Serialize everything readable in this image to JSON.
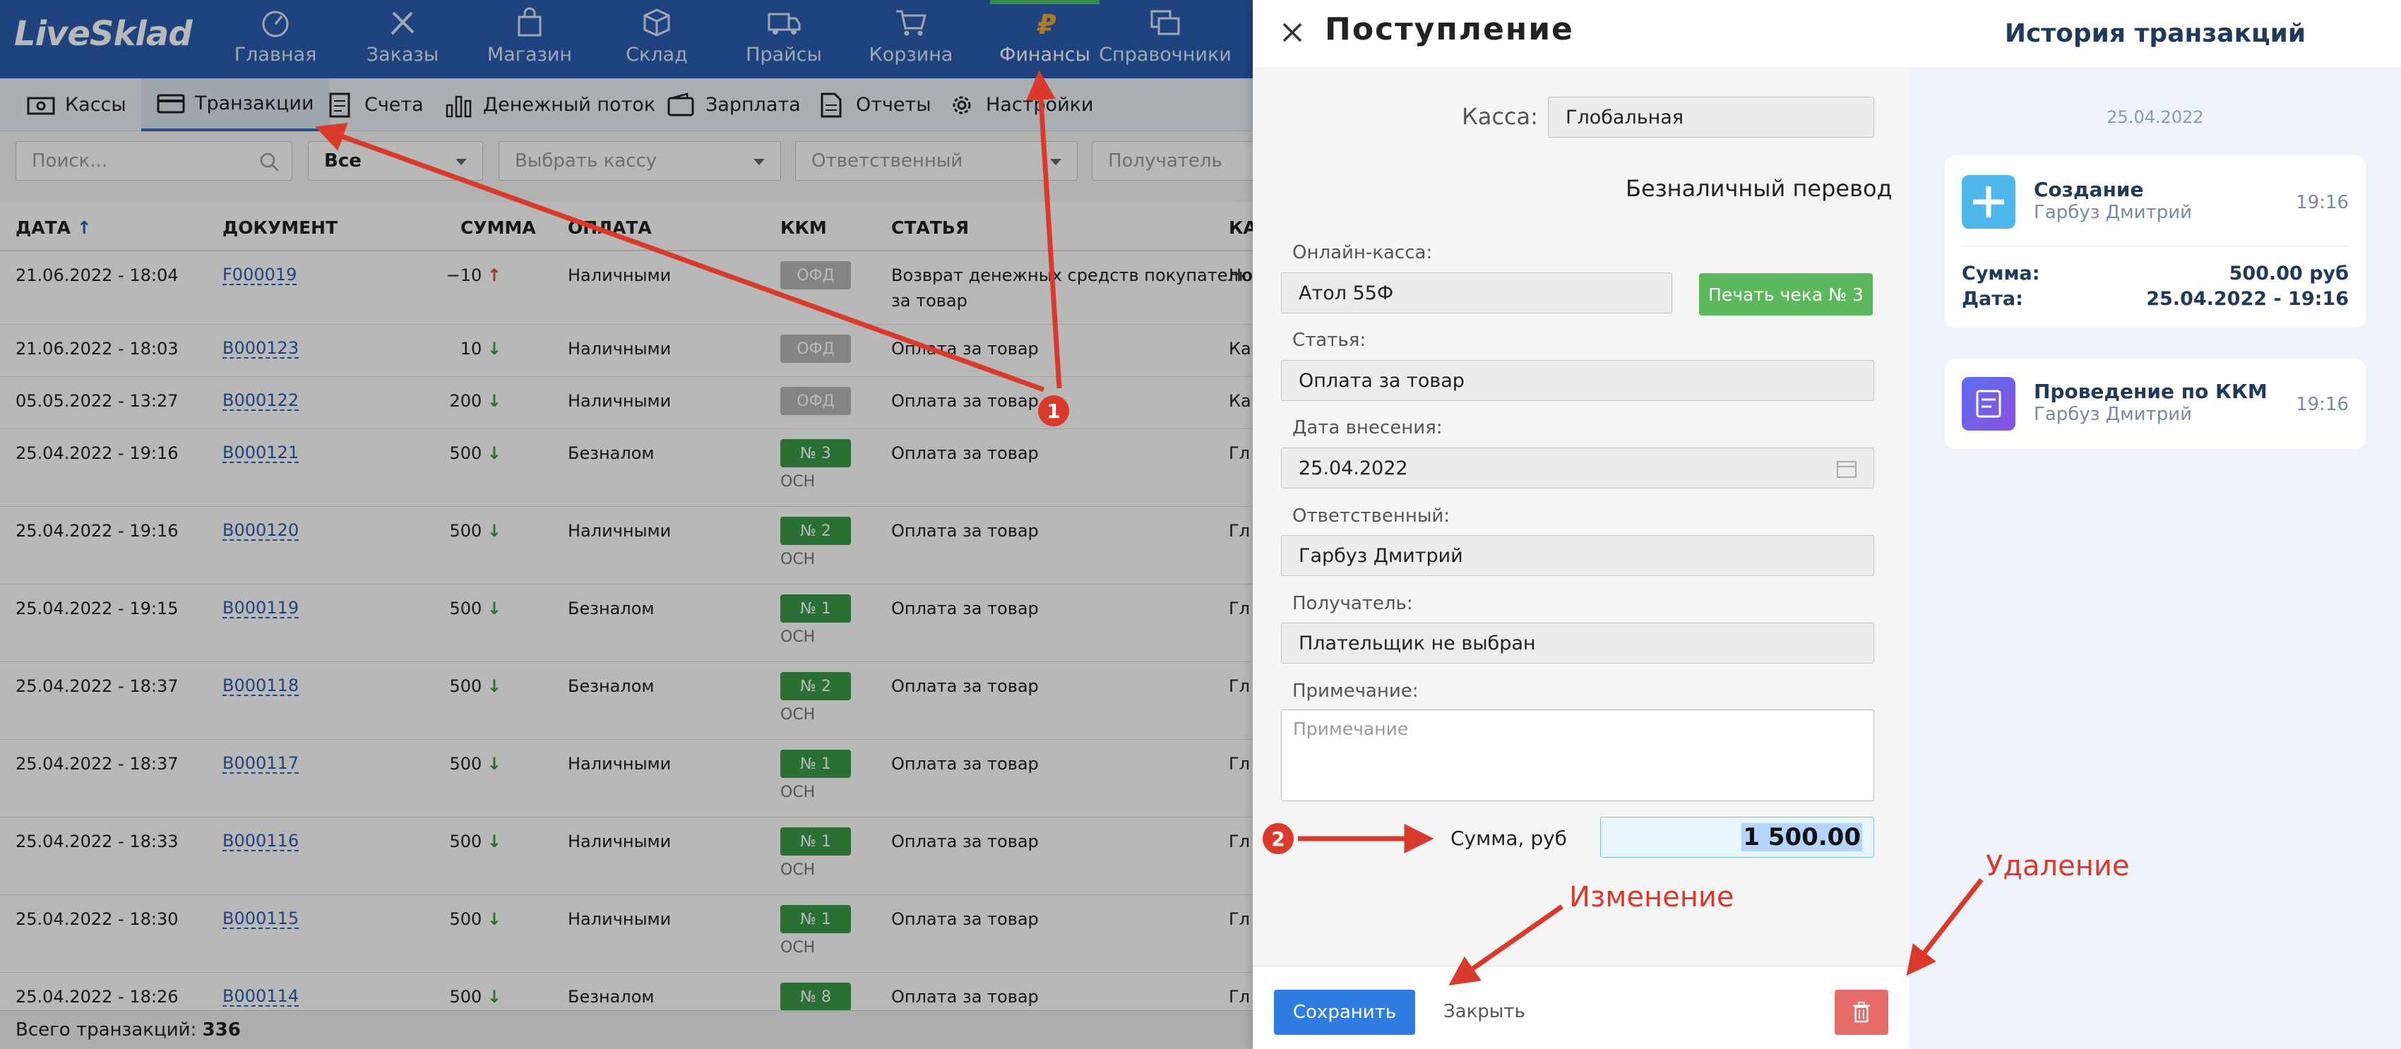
{
  "app": {
    "logo": "LiveSklad",
    "nav": [
      {
        "label": "Главная",
        "icon": "dashboard-icon"
      },
      {
        "label": "Заказы",
        "icon": "tools-icon"
      },
      {
        "label": "Магазин",
        "icon": "shopping-bag-icon"
      },
      {
        "label": "Склад",
        "icon": "box-icon"
      },
      {
        "label": "Прайсы",
        "icon": "truck-icon"
      },
      {
        "label": "Корзина",
        "icon": "cart-icon"
      },
      {
        "label": "Финансы",
        "icon": "ruble-icon"
      },
      {
        "label": "Справочники",
        "icon": "windows-icon"
      }
    ],
    "subnav": [
      {
        "label": "Кассы",
        "icon": "cash-icon"
      },
      {
        "label": "Транзакции",
        "icon": "card-icon"
      },
      {
        "label": "Счета",
        "icon": "invoice-icon"
      },
      {
        "label": "Денежный поток",
        "icon": "bar-chart-icon"
      },
      {
        "label": "Зарплата",
        "icon": "wallet-icon"
      },
      {
        "label": "Отчеты",
        "icon": "report-icon"
      },
      {
        "label": "Настройки",
        "icon": "gear-icon"
      }
    ],
    "filters": {
      "search_placeholder": "Поиск...",
      "type_value": "Все",
      "cash_placeholder": "Выбрать кассу",
      "responsible_placeholder": "Ответственный",
      "recipient_placeholder": "Получатель"
    },
    "table": {
      "headers": {
        "date": "ДАТА",
        "document": "ДОКУМЕНТ",
        "sum": "СУММА",
        "payment": "ОПЛАТА",
        "kkm": "ККМ",
        "article": "СТАТЬЯ",
        "cash": "КА"
      },
      "rows": [
        {
          "date": "21.06.2022 - 18:04",
          "doc": "F000019",
          "sum": "−10",
          "dir": "up",
          "payment": "Наличными",
          "kkm": "ОФД",
          "kkm_type": "gray",
          "osn": "",
          "article": "Возврат денежных средств покупателю",
          "article2": "за товар",
          "cash": "Но"
        },
        {
          "date": "21.06.2022 - 18:03",
          "doc": "B000123",
          "sum": "10",
          "dir": "down",
          "payment": "Наличными",
          "kkm": "ОФД",
          "kkm_type": "gray",
          "osn": "",
          "article": "Оплата за товар",
          "article2": "",
          "cash": "Ка"
        },
        {
          "date": "05.05.2022 - 13:27",
          "doc": "B000122",
          "sum": "200",
          "dir": "down",
          "payment": "Наличными",
          "kkm": "ОФД",
          "kkm_type": "gray",
          "osn": "",
          "article": "Оплата за товар",
          "article2": "",
          "cash": "Ка"
        },
        {
          "date": "25.04.2022 - 19:16",
          "doc": "B000121",
          "sum": "500",
          "dir": "down",
          "payment": "Безналом",
          "kkm": "№ 3",
          "kkm_type": "green",
          "osn": "ОСН",
          "article": "Оплата за товар",
          "article2": "",
          "cash": "Гл"
        },
        {
          "date": "25.04.2022 - 19:16",
          "doc": "B000120",
          "sum": "500",
          "dir": "down",
          "payment": "Наличными",
          "kkm": "№ 2",
          "kkm_type": "green",
          "osn": "ОСН",
          "article": "Оплата за товар",
          "article2": "",
          "cash": "Гл"
        },
        {
          "date": "25.04.2022 - 19:15",
          "doc": "B000119",
          "sum": "500",
          "dir": "down",
          "payment": "Безналом",
          "kkm": "№ 1",
          "kkm_type": "green",
          "osn": "ОСН",
          "article": "Оплата за товар",
          "article2": "",
          "cash": "Гл"
        },
        {
          "date": "25.04.2022 - 18:37",
          "doc": "B000118",
          "sum": "500",
          "dir": "down",
          "payment": "Безналом",
          "kkm": "№ 2",
          "kkm_type": "green",
          "osn": "ОСН",
          "article": "Оплата за товар",
          "article2": "",
          "cash": "Гл"
        },
        {
          "date": "25.04.2022 - 18:37",
          "doc": "B000117",
          "sum": "500",
          "dir": "down",
          "payment": "Наличными",
          "kkm": "№ 1",
          "kkm_type": "green",
          "osn": "ОСН",
          "article": "Оплата за товар",
          "article2": "",
          "cash": "Гл"
        },
        {
          "date": "25.04.2022 - 18:33",
          "doc": "B000116",
          "sum": "500",
          "dir": "down",
          "payment": "Наличными",
          "kkm": "№ 1",
          "kkm_type": "green",
          "osn": "ОСН",
          "article": "Оплата за товар",
          "article2": "",
          "cash": "Гл"
        },
        {
          "date": "25.04.2022 - 18:30",
          "doc": "B000115",
          "sum": "500",
          "dir": "down",
          "payment": "Наличными",
          "kkm": "№ 1",
          "kkm_type": "green",
          "osn": "ОСН",
          "article": "Оплата за товар",
          "article2": "",
          "cash": "Гл"
        },
        {
          "date": "25.04.2022 - 18:26",
          "doc": "B000114",
          "sum": "500",
          "dir": "down",
          "payment": "Безналом",
          "kkm": "№ 8",
          "kkm_type": "green",
          "osn": "",
          "article": "Оплата за товар",
          "article2": "",
          "cash": "Гл"
        }
      ]
    },
    "footer": {
      "label": "Всего транзакций:",
      "count": "336"
    }
  },
  "modal": {
    "title": "Поступление",
    "cash_label": "Касса:",
    "cash_value": "Глобальная",
    "payment_type": "Безналичный перевод",
    "online_kkm_label": "Онлайн-касса:",
    "online_kkm_value": "Атол 55Ф",
    "print_button": "Печать чека № 3",
    "article_label": "Статья:",
    "article_value": "Оплата за товар",
    "date_label": "Дата внесения:",
    "date_value": "25.04.2022",
    "responsible_label": "Ответственный:",
    "responsible_value": "Гарбуз Дмитрий",
    "recipient_label": "Получатель:",
    "recipient_value": "Плательщик не выбран",
    "note_label": "Примечание:",
    "note_placeholder": "Примечание",
    "sum_label": "Сумма, руб",
    "sum_value": "1 500.00",
    "save_button": "Сохранить",
    "close_button": "Закрыть"
  },
  "history": {
    "title": "История транзакций",
    "date": "25.04.2022",
    "cards": [
      {
        "title": "Создание",
        "user": "Гарбуз Дмитрий",
        "time": "19:16",
        "sum_label": "Сумма:",
        "sum_value": "500.00 руб",
        "date_label": "Дата:",
        "date_value": "25.04.2022 - 19:16"
      },
      {
        "title": "Проведение по ККМ",
        "user": "Гарбуз Дмитрий",
        "time": "19:16"
      }
    ]
  },
  "annotations": {
    "marker1": "1",
    "marker2": "2",
    "edit_label": "Изменение",
    "delete_label": "Удаление"
  },
  "colors": {
    "nav_bg": "#2a5db0",
    "accent_green": "#5cb85c",
    "primary_blue": "#2f7de1",
    "danger": "#e86b6b",
    "annotation_red": "#d93a2b"
  }
}
